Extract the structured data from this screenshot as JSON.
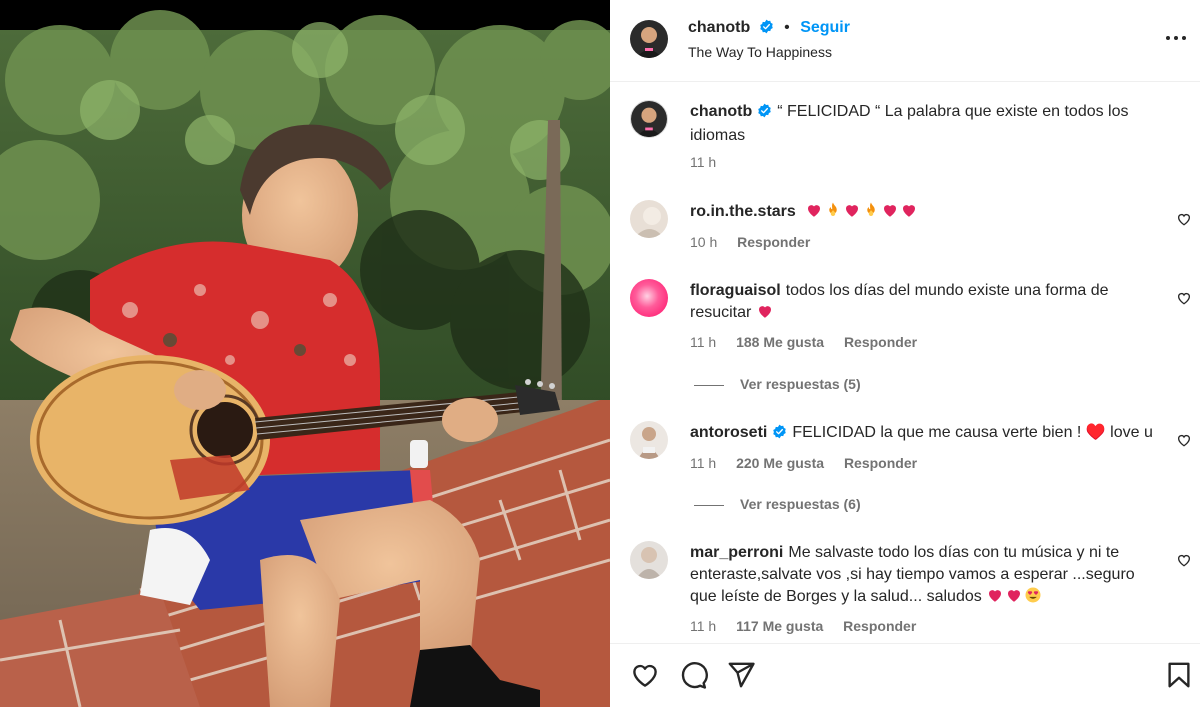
{
  "post": {
    "author": "chanotb",
    "follow_label": "Seguir",
    "location": "The Way To Happiness",
    "caption": "“ FELICIDAD “ La palabra que existe en todos los idiomas",
    "caption_time": "11 h"
  },
  "comments": [
    {
      "username": "ro.in.the.stars",
      "text": "",
      "emojis": [
        "heart",
        "fire",
        "heart",
        "fire",
        "heart",
        "heart"
      ],
      "time": "10 h",
      "likes": "",
      "reply_label": "Responder",
      "avatar_color": "#e8dfd6",
      "verified": false
    },
    {
      "username": "floraguaisol",
      "text": "todos los días del mundo existe una forma de resucitar",
      "emojis": [
        "heart"
      ],
      "time": "11 h",
      "likes": "188 Me gusta",
      "reply_label": "Responder",
      "view_replies": "Ver respuestas (5)",
      "avatar_color": "#ff3d8b",
      "verified": false
    },
    {
      "username": "antoroseti",
      "text": "FELICIDAD la que me causa verte bien ! ♥️ love u",
      "emojis": [],
      "time": "11 h",
      "likes": "220 Me gusta",
      "reply_label": "Responder",
      "view_replies": "Ver respuestas (6)",
      "avatar_color": "#c9bdb3",
      "verified": true
    },
    {
      "username": "mar_perroni",
      "text": "Me salvaste todo los días con tu música y ni te enteraste,salvate vos ,si hay tiempo vamos a esperar ...seguro que leíste de Borges y la salud... saludos",
      "emojis": [
        "heart",
        "heart",
        "heart-eyes"
      ],
      "time": "11 h",
      "likes": "117 Me gusta",
      "reply_label": "Responder",
      "avatar_color": "#d9d4cf",
      "verified": false
    }
  ],
  "icons": {
    "like": "heart-icon",
    "comment": "comment-icon",
    "share": "share-icon",
    "save": "bookmark-icon",
    "more": "more-options-icon",
    "verified": "verified-badge-icon"
  },
  "colors": {
    "accent": "#0095f6",
    "verified": "#0095f6",
    "muted": "#737373"
  }
}
